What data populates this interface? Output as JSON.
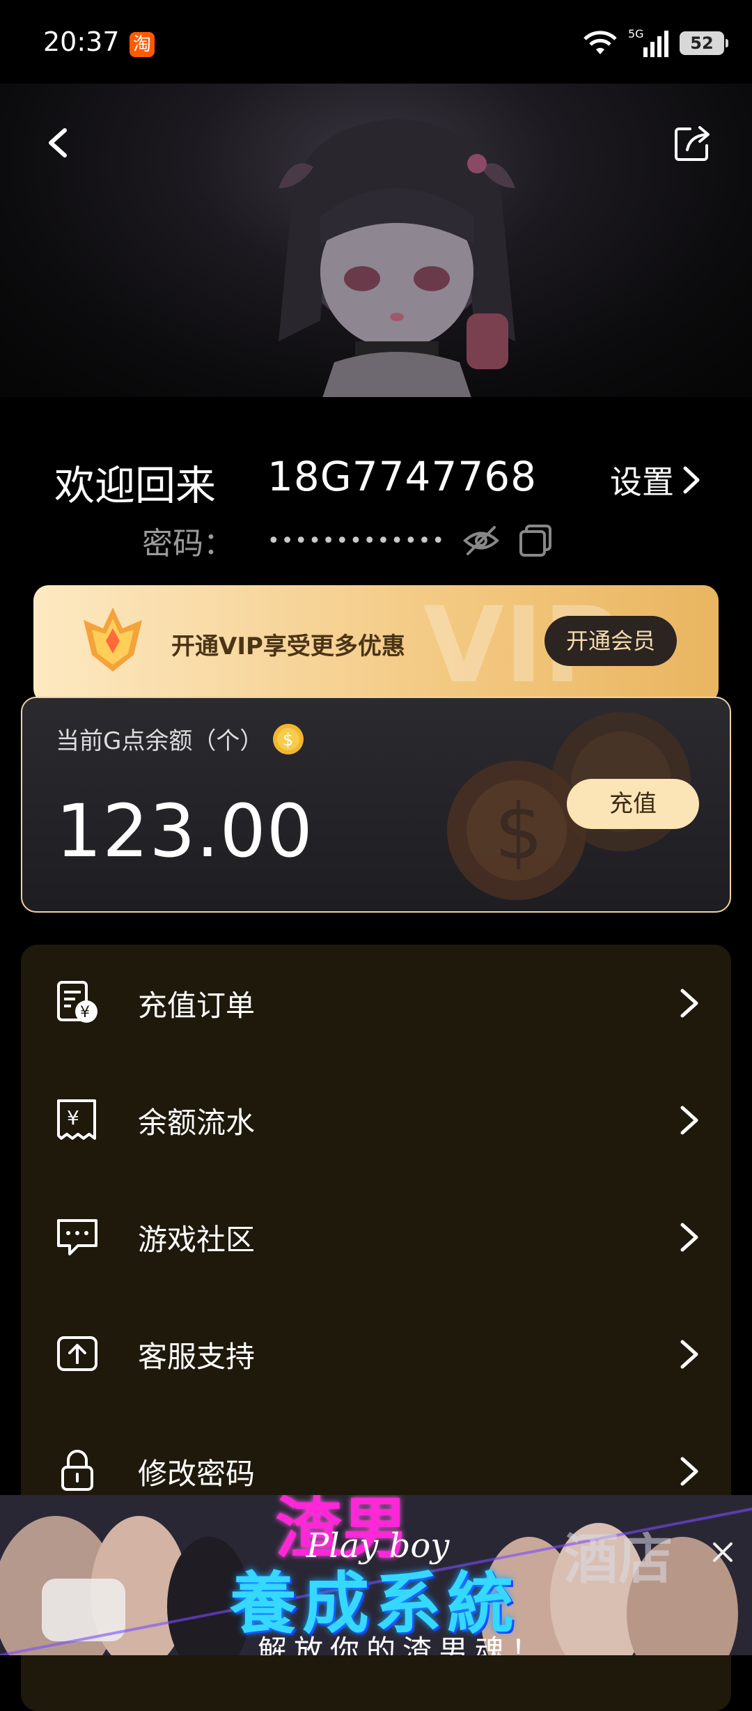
{
  "status_bar": {
    "time": "20:37",
    "taobao_badge": "淘",
    "network": "5G",
    "battery": "52"
  },
  "hero": {
    "back_icon": "chevron-left-icon",
    "share_icon": "share-icon"
  },
  "account": {
    "welcome": "欢迎回来",
    "id": "18G7747768",
    "settings": "设置",
    "password_label": "密码：",
    "password_masked": "•••••••••••••"
  },
  "vip": {
    "promo_text": "开通VIP享受更多优惠",
    "button_label": "开通会员",
    "watermark": "VIP"
  },
  "balance": {
    "label": "当前G点余额（个）",
    "value": "123.00",
    "recharge_label": "充值"
  },
  "menu": {
    "items": [
      {
        "label": "充值订单",
        "icon": "receipt-yuan-icon"
      },
      {
        "label": "余额流水",
        "icon": "ledger-icon"
      },
      {
        "label": "游戏社区",
        "icon": "chat-bubble-icon"
      },
      {
        "label": "客服支持",
        "icon": "upload-support-icon"
      },
      {
        "label": "修改密码",
        "icon": "lock-icon"
      }
    ]
  },
  "ad": {
    "title_top": "渣男",
    "script": "Play boy",
    "title": "養成系統",
    "subtitle": "解放你的渣男魂！",
    "hotel": "酒店"
  },
  "colors": {
    "accent_gold": "#f3c982",
    "menu_bg": "#1e190b",
    "card_border": "#f0d2a0"
  }
}
